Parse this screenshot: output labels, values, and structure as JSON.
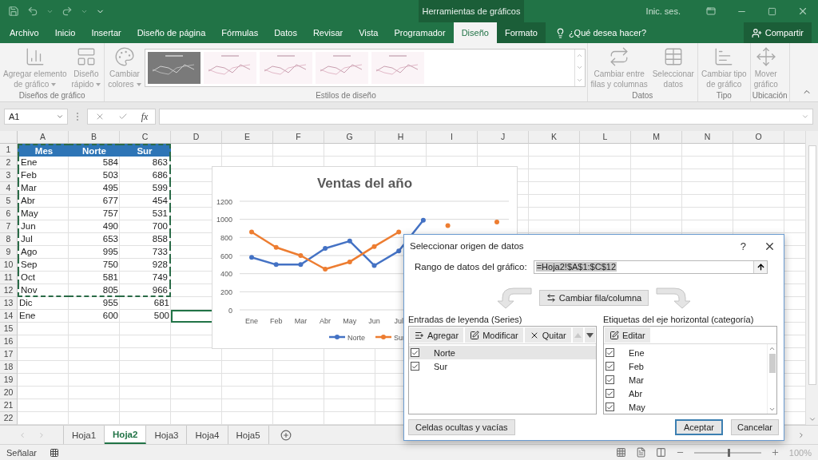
{
  "title_bar": {
    "context_title": "Herramientas de gráficos",
    "sign_in": "Inic. ses."
  },
  "ribbon_tabs": [
    {
      "label": "Archivo",
      "selected": false,
      "context": false
    },
    {
      "label": "Inicio",
      "selected": false,
      "context": false
    },
    {
      "label": "Insertar",
      "selected": false,
      "context": false
    },
    {
      "label": "Diseño de página",
      "selected": false,
      "context": false
    },
    {
      "label": "Fórmulas",
      "selected": false,
      "context": false
    },
    {
      "label": "Datos",
      "selected": false,
      "context": false
    },
    {
      "label": "Revisar",
      "selected": false,
      "context": false
    },
    {
      "label": "Vista",
      "selected": false,
      "context": false
    },
    {
      "label": "Programador",
      "selected": false,
      "context": false
    },
    {
      "label": "Diseño",
      "selected": true,
      "context": true
    },
    {
      "label": "Formato",
      "selected": false,
      "context": true
    }
  ],
  "tell_me": "¿Qué desea hacer?",
  "share_button": "Compartir",
  "ribbon_groups": [
    {
      "title": "Diseños de gráfico",
      "items": [
        {
          "lines": [
            "Agregar elemento",
            "de gráfico"
          ],
          "dropdown": true
        },
        {
          "lines": [
            "Diseño",
            "rápido"
          ],
          "dropdown": true
        }
      ]
    },
    {
      "title": "Estilos de diseño",
      "items": [
        {
          "lines": [
            "Cambiar",
            "colores"
          ],
          "dropdown": true
        }
      ],
      "gallery": [
        {
          "kind": "picture"
        },
        {
          "kind": "picture"
        },
        {
          "kind": "picture"
        },
        {
          "kind": "picture"
        },
        {
          "kind": "picture"
        }
      ]
    },
    {
      "title": "Datos",
      "items": [
        {
          "lines": [
            "Cambiar entre",
            "filas y columnas"
          ],
          "dropdown": false
        },
        {
          "lines": [
            "Seleccionar",
            "datos"
          ],
          "dropdown": false
        }
      ]
    },
    {
      "title": "Tipo",
      "items": [
        {
          "lines": [
            "Cambiar tipo",
            "de gráfico"
          ],
          "dropdown": false
        }
      ]
    },
    {
      "title": "Ubicación",
      "items": [
        {
          "lines": [
            "Mover",
            "gráfico"
          ],
          "dropdown": false
        }
      ]
    }
  ],
  "formula_bar": {
    "name_box": "A1",
    "function_label": "fx"
  },
  "sheet": {
    "columns": [
      "A",
      "B",
      "C",
      "D",
      "E",
      "F",
      "G",
      "H",
      "I",
      "J",
      "K",
      "L",
      "M",
      "N",
      "O"
    ],
    "rows": [
      {
        "number": "1",
        "cells": [
          "Mes",
          "Norte",
          "Sur"
        ],
        "header": true,
        "in_copy_range": true,
        "active_cell": false
      },
      {
        "number": "2",
        "cells": [
          "Ene",
          "584",
          "863"
        ],
        "header": false,
        "in_copy_range": true,
        "active_cell": false
      },
      {
        "number": "3",
        "cells": [
          "Feb",
          "503",
          "686"
        ],
        "header": false,
        "in_copy_range": true,
        "active_cell": false
      },
      {
        "number": "4",
        "cells": [
          "Mar",
          "495",
          "599"
        ],
        "header": false,
        "in_copy_range": true,
        "active_cell": false
      },
      {
        "number": "5",
        "cells": [
          "Abr",
          "677",
          "454"
        ],
        "header": false,
        "in_copy_range": true,
        "active_cell": false
      },
      {
        "number": "6",
        "cells": [
          "May",
          "757",
          "531"
        ],
        "header": false,
        "in_copy_range": true,
        "active_cell": false
      },
      {
        "number": "7",
        "cells": [
          "Jun",
          "490",
          "700"
        ],
        "header": false,
        "in_copy_range": true,
        "active_cell": false
      },
      {
        "number": "8",
        "cells": [
          "Jul",
          "653",
          "858"
        ],
        "header": false,
        "in_copy_range": true,
        "active_cell": false
      },
      {
        "number": "9",
        "cells": [
          "Ago",
          "995",
          "733"
        ],
        "header": false,
        "in_copy_range": true,
        "active_cell": false
      },
      {
        "number": "10",
        "cells": [
          "Sep",
          "750",
          "928"
        ],
        "header": false,
        "in_copy_range": true,
        "active_cell": false
      },
      {
        "number": "11",
        "cells": [
          "Oct",
          "581",
          "749"
        ],
        "header": false,
        "in_copy_range": true,
        "active_cell": false
      },
      {
        "number": "12",
        "cells": [
          "Nov",
          "805",
          "966"
        ],
        "header": false,
        "in_copy_range": true,
        "active_cell": false
      },
      {
        "number": "13",
        "cells": [
          "Dic",
          "955",
          "681"
        ],
        "header": false,
        "in_copy_range": false,
        "active_cell": false
      },
      {
        "number": "14",
        "cells": [
          "Ene",
          "600",
          "500"
        ],
        "header": false,
        "in_copy_range": false,
        "active_cell": true
      },
      {
        "number": "15",
        "cells": [],
        "header": false,
        "in_copy_range": false,
        "active_cell": false
      },
      {
        "number": "16",
        "cells": [],
        "header": false,
        "in_copy_range": false,
        "active_cell": false
      },
      {
        "number": "17",
        "cells": [],
        "header": false,
        "in_copy_range": false,
        "active_cell": false
      },
      {
        "number": "18",
        "cells": [],
        "header": false,
        "in_copy_range": false,
        "active_cell": false
      },
      {
        "number": "19",
        "cells": [],
        "header": false,
        "in_copy_range": false,
        "active_cell": false
      },
      {
        "number": "20",
        "cells": [],
        "header": false,
        "in_copy_range": false,
        "active_cell": false
      },
      {
        "number": "21",
        "cells": [],
        "header": false,
        "in_copy_range": false,
        "active_cell": false
      },
      {
        "number": "22",
        "cells": [],
        "header": false,
        "in_copy_range": false,
        "active_cell": false
      }
    ],
    "chart": {
      "chart_data": {
        "type": "line",
        "title": "Ventas del año",
        "categories": [
          "Ene",
          "Feb",
          "Mar",
          "Abr",
          "May",
          "Jun",
          "Jul",
          null,
          null,
          null,
          null
        ],
        "series": [
          {
            "name": "Norte",
            "color": "#4472c4",
            "marker": "circle",
            "values": [
              580,
              500,
              500,
              680,
              760,
              490,
              650,
              990,
              null,
              null,
              null
            ]
          },
          {
            "name": "Sur",
            "color": "#ed7d31",
            "marker": "circle",
            "values": [
              860,
              690,
              600,
              450,
              530,
              700,
              860,
              null,
              930,
              null,
              970
            ]
          }
        ],
        "ylim": [
          0,
          1200
        ],
        "yticks": [
          0,
          200,
          400,
          600,
          800,
          1000,
          1200
        ],
        "grid": true,
        "legend": true
      }
    },
    "tabs": [
      {
        "label": "Hoja1",
        "selected": false
      },
      {
        "label": "Hoja2",
        "selected": true
      },
      {
        "label": "Hoja3",
        "selected": false
      },
      {
        "label": "Hoja4",
        "selected": false
      },
      {
        "label": "Hoja5",
        "selected": false
      }
    ]
  },
  "status_bar": {
    "mode": "Señalar",
    "zoom": {
      "level": 0.5,
      "reading": "100%"
    }
  },
  "dialog": {
    "title": "Seleccionar origen de datos",
    "help": "?",
    "range_label": "Rango de datos del gráfico:",
    "range_value": "=Hoja2!$A$1:$C$12",
    "switch_button": "Cambiar fila/columna",
    "series_panel": {
      "title": "Entradas de leyenda (Series)",
      "buttons": [
        {
          "label": "Agregar",
          "kind": "add"
        },
        {
          "label": "Modificar",
          "kind": "edit"
        },
        {
          "label": "Quitar",
          "kind": "remove"
        }
      ],
      "move_buttons": [
        {
          "kind": "up",
          "disabled": true
        },
        {
          "kind": "down",
          "disabled": false
        }
      ],
      "items": [
        {
          "label": "Norte",
          "checked": true,
          "selected": true
        },
        {
          "label": "Sur",
          "checked": true,
          "selected": false
        }
      ]
    },
    "category_panel": {
      "title": "Etiquetas del eje horizontal (categoría)",
      "button": "Editar",
      "items": [
        {
          "label": "Ene",
          "checked": true
        },
        {
          "label": "Feb",
          "checked": true
        },
        {
          "label": "Mar",
          "checked": true
        },
        {
          "label": "Abr",
          "checked": true
        },
        {
          "label": "May",
          "checked": true
        }
      ]
    },
    "hidden_cells_button": "Celdas ocultas y vacías",
    "ok_button": "Aceptar",
    "cancel_button": "Cancelar"
  }
}
